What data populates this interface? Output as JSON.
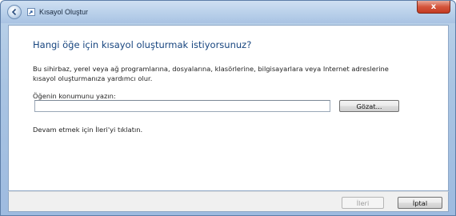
{
  "window": {
    "title": "Kısayol Oluştur",
    "close_label": "x"
  },
  "main": {
    "heading": "Hangi öğe için kısayol oluşturmak istiyorsunuz?",
    "description": "Bu sihirbaz, yerel veya ağ programlarına, dosyalarına, klasörlerine, bilgisayarlara veya Internet adreslerine kısayol oluşturmanıza yardımcı olur.",
    "field_label": "Öğenin konumunu yazın:",
    "location_value": "",
    "browse_label": "Gözat...",
    "hint": "Devam etmek için İleri'yi tıklatın."
  },
  "footer": {
    "next_label": "İleri",
    "cancel_label": "İptal"
  },
  "icons": {
    "back": "back-arrow-icon",
    "wizard": "shortcut-wizard-icon",
    "close": "close-icon"
  },
  "colors": {
    "heading": "#17457f",
    "titlebar": "#b9d0ea",
    "close_button": "#c43b22"
  }
}
